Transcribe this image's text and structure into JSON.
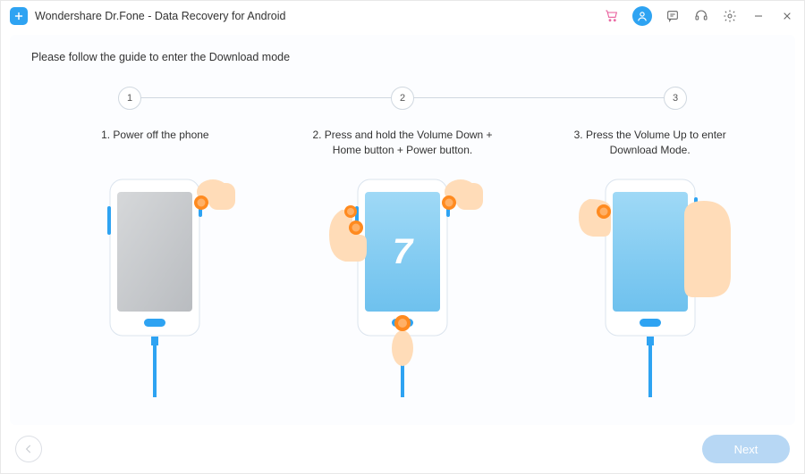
{
  "titlebar": {
    "title": "Wondershare Dr.Fone - Data Recovery for Android"
  },
  "main": {
    "guide_text": "Please follow the guide to enter the Download mode",
    "progress": {
      "n1": "1",
      "n2": "2",
      "n3": "3"
    },
    "steps": [
      {
        "caption": "1. Power off the phone"
      },
      {
        "caption": "2. Press and hold the Volume Down + Home button + Power button."
      },
      {
        "caption": "3. Press the Volume Up to enter Download Mode."
      }
    ],
    "phone2_screen_text": "7"
  },
  "footer": {
    "next_label": "Next"
  }
}
